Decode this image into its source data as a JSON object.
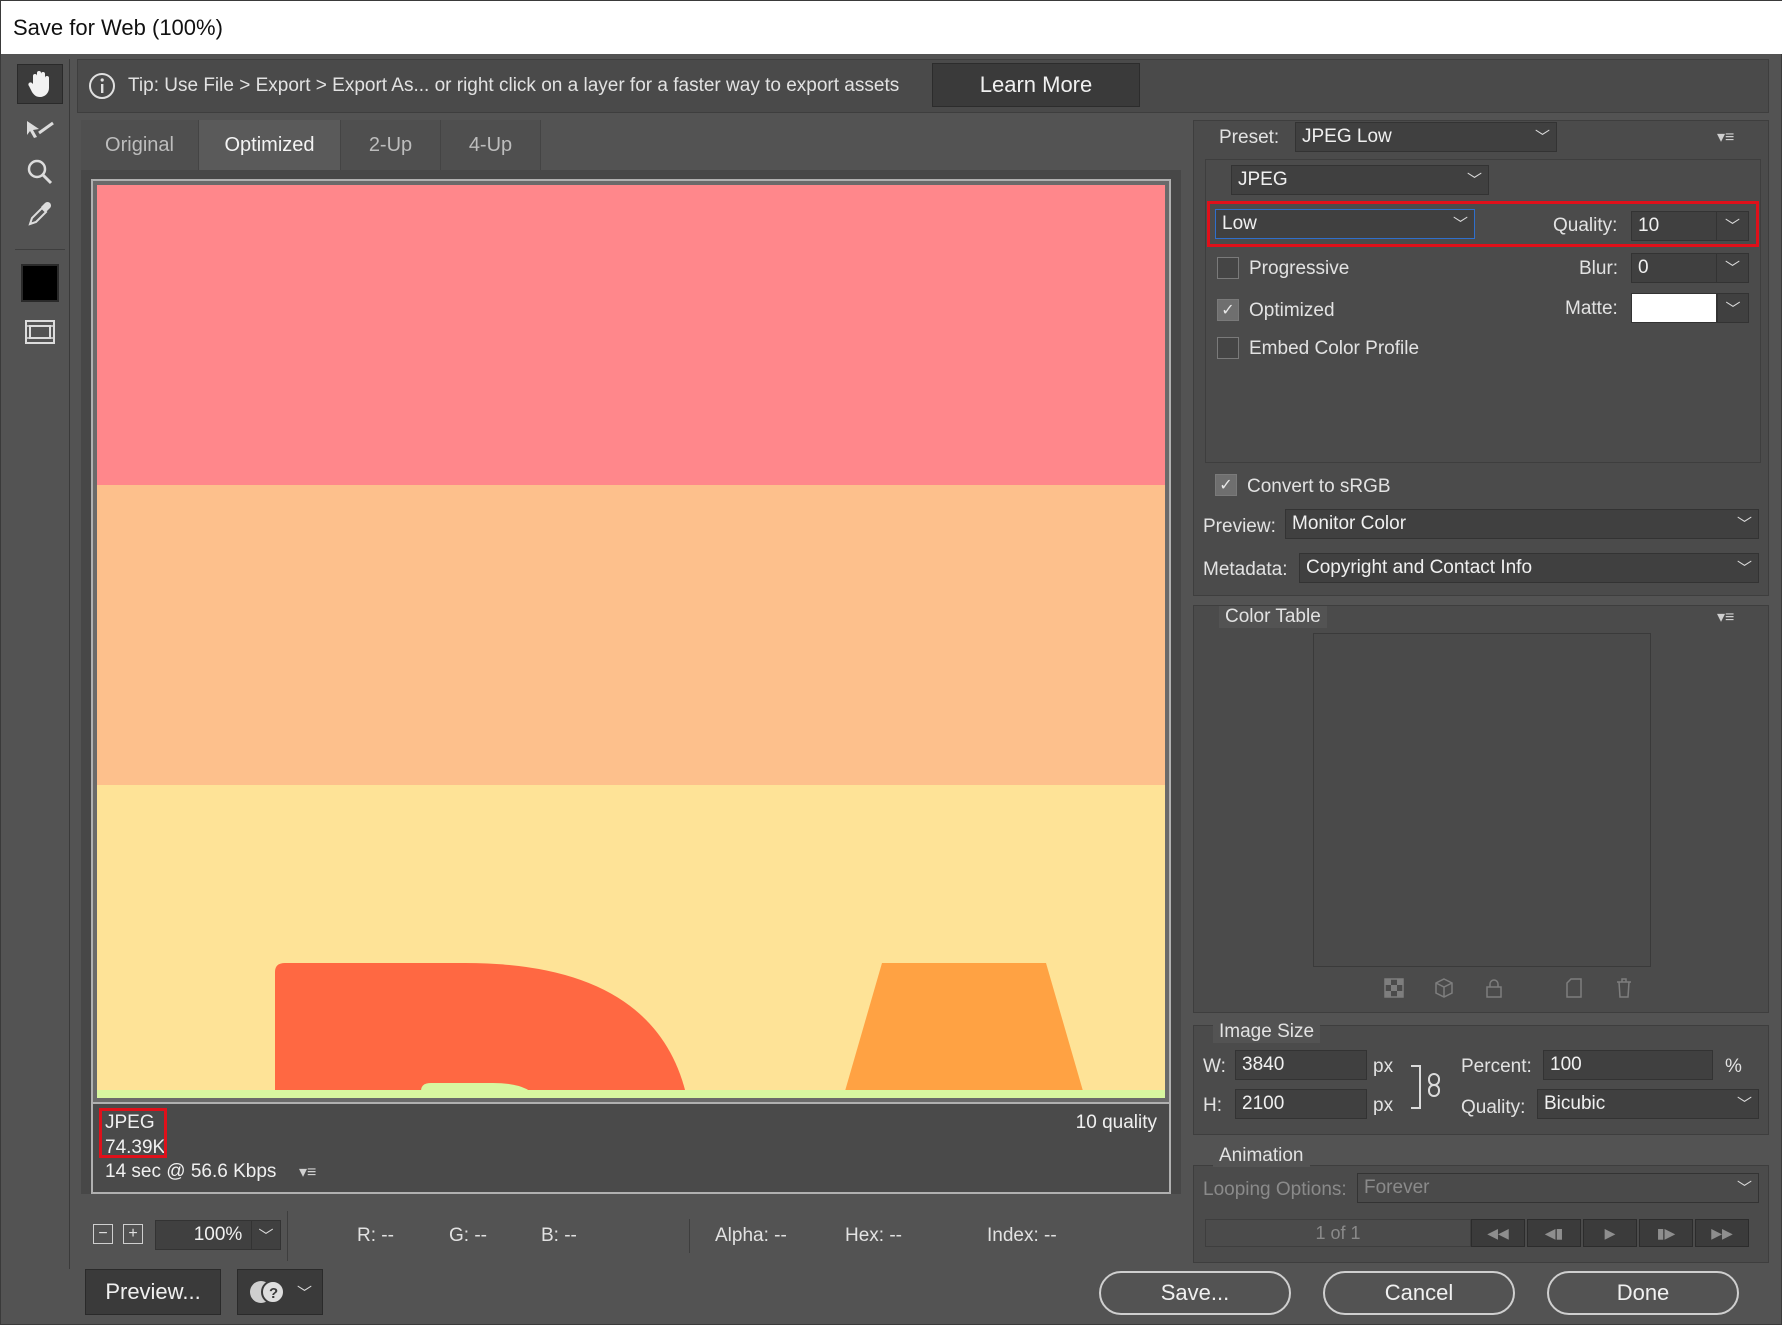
{
  "window": {
    "title": "Save for Web (100%)"
  },
  "tipbar": {
    "info_icon": "info-icon",
    "text": "Tip: Use File > Export > Export As...  or right click on a layer for a faster way to export assets",
    "learn_more": "Learn More"
  },
  "toolbar": {
    "tools": [
      "hand-icon",
      "slice-select-icon",
      "zoom-icon",
      "eyedropper-icon",
      "color-swatch",
      "toggle-slices-icon"
    ]
  },
  "tabs": [
    "Original",
    "Optimized",
    "2-Up",
    "4-Up"
  ],
  "active_tab": "Optimized",
  "canvas_info": {
    "format": "JPEG",
    "size": "74.39K",
    "download_time": "14 sec @ 56.6 Kbps",
    "quality_note": "10 quality"
  },
  "status": {
    "zoom": "100%",
    "r": "R: --",
    "g": "G: --",
    "b": "B: --",
    "alpha": "Alpha: --",
    "hex": "Hex: --",
    "index": "Index: --"
  },
  "buttons": {
    "preview": "Preview...",
    "save": "Save...",
    "cancel": "Cancel",
    "done": "Done"
  },
  "settings": {
    "preset_label": "Preset:",
    "preset_value": "JPEG Low",
    "format_value": "JPEG",
    "quality_level": "Low",
    "quality_label": "Quality:",
    "quality_value": "10",
    "progressive_label": "Progressive",
    "progressive_checked": false,
    "blur_label": "Blur:",
    "blur_value": "0",
    "optimized_label": "Optimized",
    "optimized_checked": true,
    "matte_label": "Matte:",
    "matte_color": "#ffffff",
    "embed_label": "Embed Color Profile",
    "embed_checked": false,
    "srgb_label": "Convert to sRGB",
    "srgb_checked": true,
    "preview_label": "Preview:",
    "preview_value": "Monitor Color",
    "metadata_label": "Metadata:",
    "metadata_value": "Copyright and Contact Info"
  },
  "color_table": {
    "title": "Color Table"
  },
  "image_size": {
    "title": "Image Size",
    "w_label": "W:",
    "w_value": "3840",
    "h_label": "H:",
    "h_value": "2100",
    "unit": "px",
    "percent_label": "Percent:",
    "percent_value": "100",
    "percent_unit": "%",
    "quality_label": "Quality:",
    "quality_value": "Bicubic"
  },
  "animation": {
    "title": "Animation",
    "looping_label": "Looping Options:",
    "looping_value": "Forever",
    "frame_counter": "1 of 1"
  },
  "canvas_colors": {
    "band1": "#ff878b",
    "band2": "#fdc08c",
    "band3": "#fee397",
    "letter": "#ff6842",
    "trapezoid": "#ffa243",
    "strip": "#d8f7a0"
  }
}
